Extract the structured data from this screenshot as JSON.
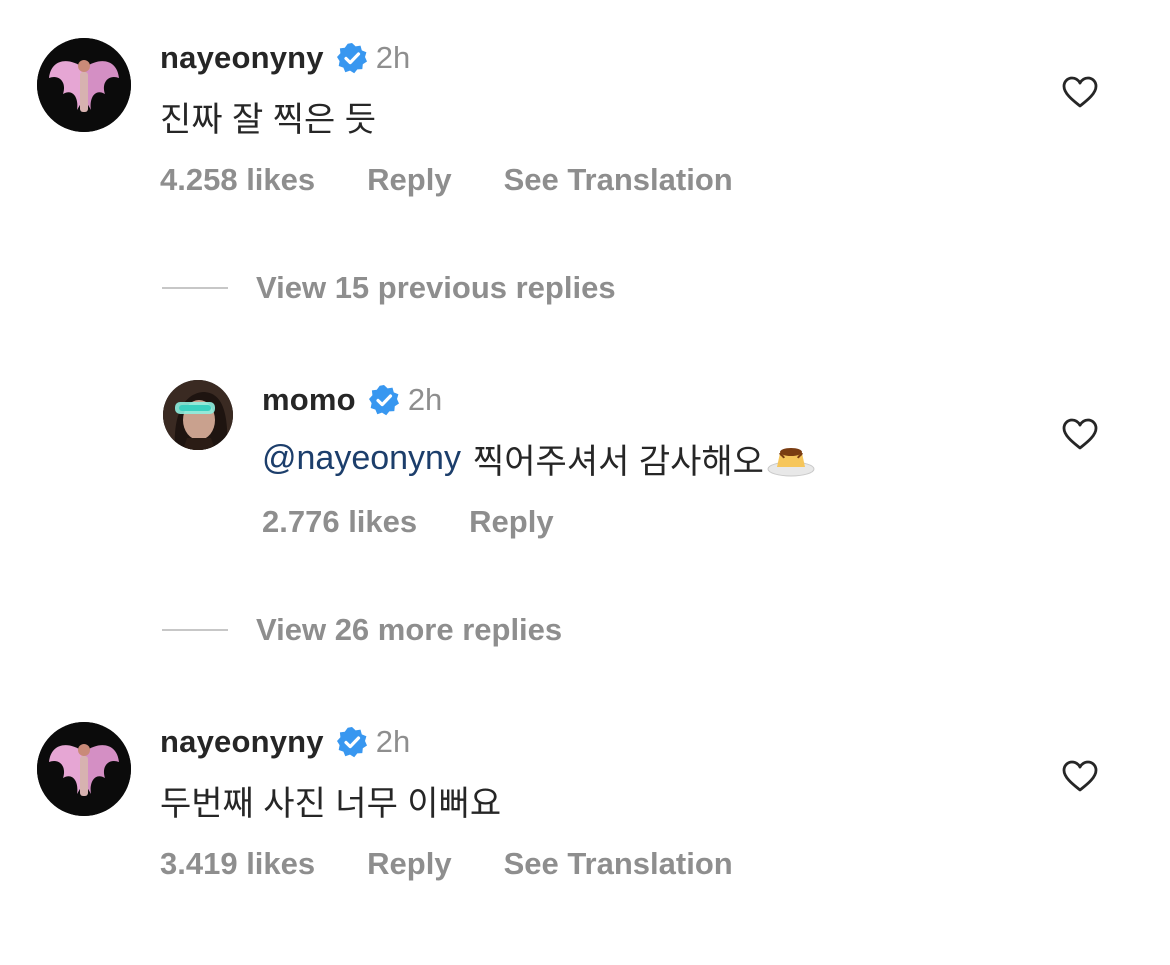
{
  "comments": [
    {
      "username": "nayeonyny",
      "time": "2h",
      "text": "진짜 잘 찍은 듯",
      "likes": "4.258 likes",
      "reply": "Reply",
      "translate": "See Translation"
    },
    {
      "username": "momo",
      "time": "2h",
      "mention": "@nayeonyny",
      "text": "찍어주셔서 감사해오",
      "emoji": "pudding-emoji",
      "likes": "2.776 likes",
      "reply": "Reply"
    },
    {
      "username": "nayeonyny",
      "time": "2h",
      "text": "두번째 사진 너무 이뻐요",
      "likes": "3.419 likes",
      "reply": "Reply",
      "translate": "See Translation"
    }
  ],
  "view_previous": "View 15 previous replies",
  "view_more": "View 26 more replies",
  "icons": {
    "verified": "verified-badge-icon",
    "like": "heart-icon"
  },
  "colors": {
    "verified": "#3897f0",
    "mention": "#1c3e6b",
    "secondary": "#8e8e8e"
  }
}
